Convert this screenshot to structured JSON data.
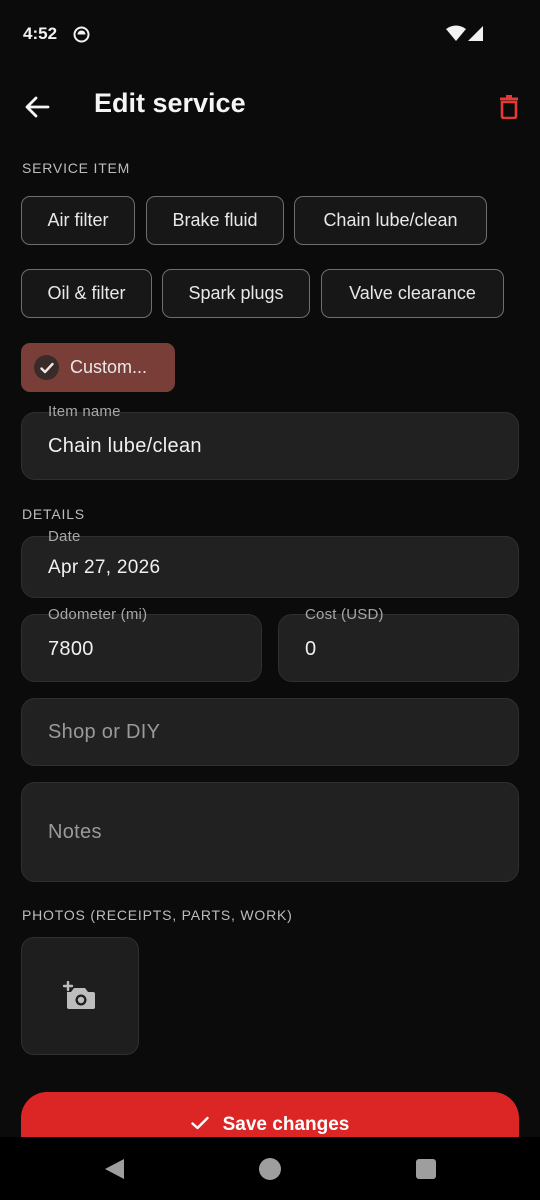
{
  "status_bar": {
    "time": "4:52"
  },
  "header": {
    "title": "Edit service"
  },
  "service_item": {
    "section_label": "SERVICE ITEM",
    "chips": [
      "Air filter",
      "Brake fluid",
      "Chain lube/clean",
      "Oil & filter",
      "Spark plugs",
      "Valve clearance"
    ],
    "custom_chip": "Custom..."
  },
  "item_name": {
    "label": "Item name",
    "value": "Chain lube/clean"
  },
  "details": {
    "section_label": "DETAILS",
    "date": {
      "label": "Date",
      "value": "Apr 27, 2026"
    },
    "odometer": {
      "label": "Odometer (mi)",
      "value": "7800"
    },
    "cost": {
      "label": "Cost (USD)",
      "value": "0"
    },
    "shop": {
      "placeholder": "Shop or DIY"
    },
    "notes": {
      "placeholder": "Notes"
    }
  },
  "photos": {
    "section_label": "PHOTOS (RECEIPTS, PARTS, WORK)"
  },
  "save_button": {
    "label": "Save changes"
  },
  "colors": {
    "accent": "#dc2626",
    "custom_chip_bg": "#7a3e38",
    "background": "#0b0b0b",
    "field_bg": "#212121"
  },
  "icons": [
    "back-arrow-icon",
    "trash-icon",
    "check-icon",
    "add-photo-icon",
    "nav-back-icon",
    "nav-home-icon",
    "nav-recents-icon"
  ]
}
